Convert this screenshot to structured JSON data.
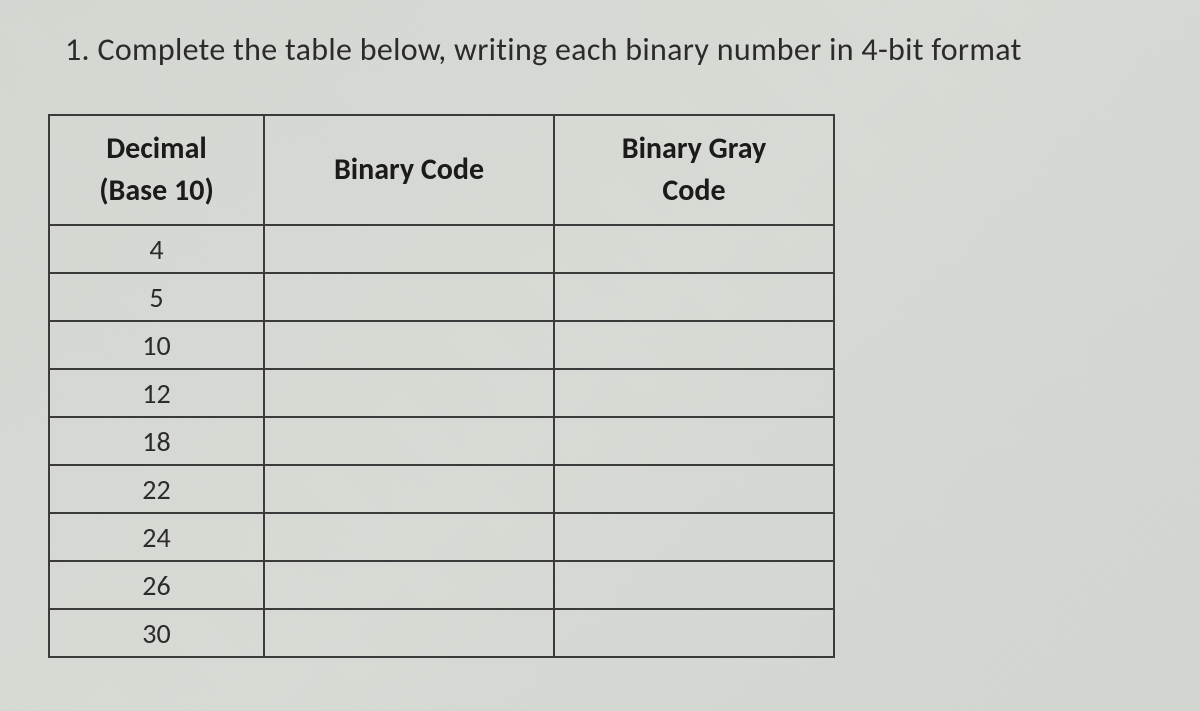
{
  "question": {
    "number": "1.",
    "text": "Complete the table below, writing each binary number in 4-bit format"
  },
  "table": {
    "headers": {
      "decimal_line1": "Decimal",
      "decimal_line2": "(Base 10)",
      "binary": "Binary Code",
      "gray_line1": "Binary Gray",
      "gray_line2": "Code"
    },
    "rows": [
      {
        "decimal": "4",
        "binary": "",
        "gray": ""
      },
      {
        "decimal": "5",
        "binary": "",
        "gray": ""
      },
      {
        "decimal": "10",
        "binary": "",
        "gray": ""
      },
      {
        "decimal": "12",
        "binary": "",
        "gray": ""
      },
      {
        "decimal": "18",
        "binary": "",
        "gray": ""
      },
      {
        "decimal": "22",
        "binary": "",
        "gray": ""
      },
      {
        "decimal": "24",
        "binary": "",
        "gray": ""
      },
      {
        "decimal": "26",
        "binary": "",
        "gray": ""
      },
      {
        "decimal": "30",
        "binary": "",
        "gray": ""
      }
    ]
  }
}
